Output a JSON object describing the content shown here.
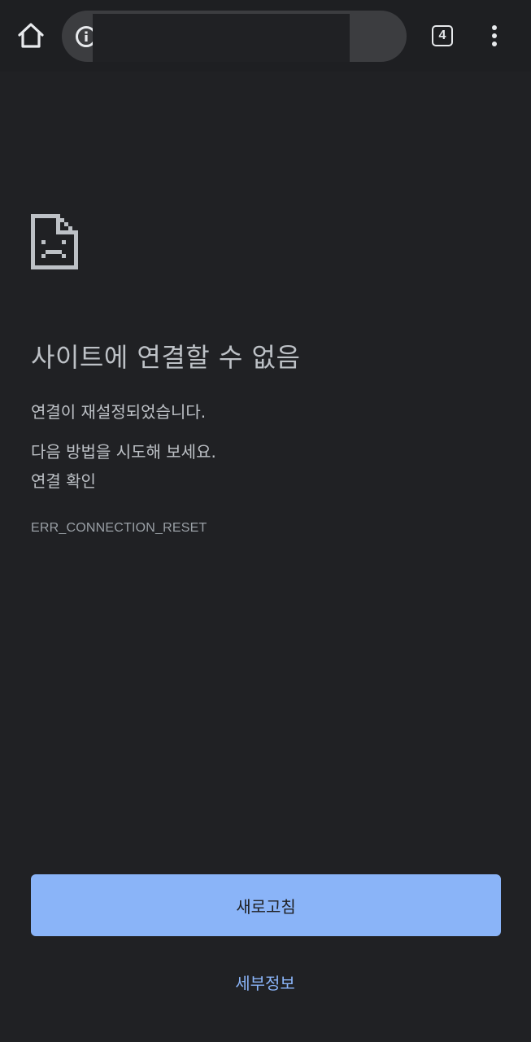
{
  "toolbar": {
    "url": "",
    "tab_count": "4",
    "icons": {
      "home": "home-icon",
      "info": "info-icon",
      "tabs": "tab-switcher-icon",
      "menu": "more-vert-icon"
    }
  },
  "error": {
    "icon": "sad-page-icon",
    "title": "사이트에 연결할 수 없음",
    "description": "연결이 재설정되었습니다.",
    "suggestions_heading": "다음 방법을 시도해 보세요.",
    "suggestions": [
      "연결 확인"
    ],
    "code": "ERR_CONNECTION_RESET"
  },
  "actions": {
    "reload_label": "새로고침",
    "details_label": "세부정보"
  },
  "colors": {
    "background": "#202124",
    "toolbar": "#1e1f22",
    "omnibox": "#3c3d40",
    "text": "#bdc1c6",
    "accent": "#8ab4f8"
  }
}
